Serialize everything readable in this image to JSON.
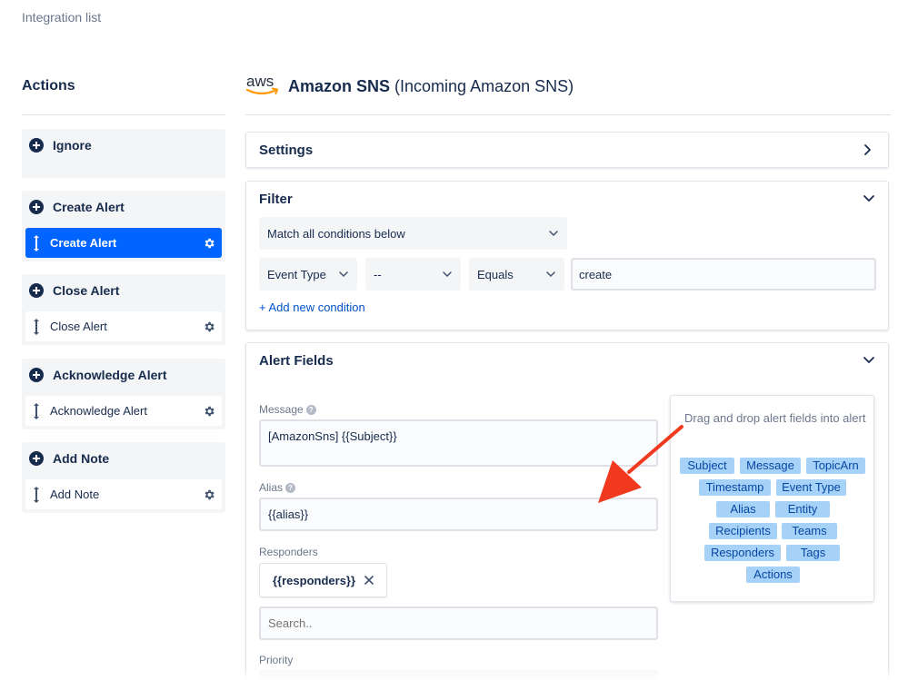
{
  "breadcrumb": "Integration list",
  "actions": {
    "title": "Actions",
    "groups": [
      {
        "head": "Ignore",
        "items": []
      },
      {
        "head": "Create Alert",
        "items": [
          {
            "label": "Create Alert",
            "active": true
          }
        ]
      },
      {
        "head": "Close Alert",
        "items": [
          {
            "label": "Close Alert",
            "active": false
          }
        ]
      },
      {
        "head": "Acknowledge Alert",
        "items": [
          {
            "label": "Acknowledge Alert",
            "active": false
          }
        ]
      },
      {
        "head": "Add Note",
        "items": [
          {
            "label": "Add Note",
            "active": false
          }
        ]
      }
    ]
  },
  "header": {
    "logo_text": "aws",
    "title_bold": "Amazon SNS",
    "title_rest": " (Incoming Amazon SNS)"
  },
  "settings": {
    "title": "Settings"
  },
  "filter": {
    "title": "Filter",
    "match_select": "Match all conditions below",
    "condition": {
      "field": "Event Type",
      "operator_not": "--",
      "operator": "Equals",
      "value": "create"
    },
    "add_condition": "+ Add new condition"
  },
  "alert_fields": {
    "title": "Alert Fields",
    "message_label": "Message",
    "message_value": "[AmazonSns] {{Subject}}",
    "alias_label": "Alias",
    "alias_value": "{{alias}}",
    "responders_label": "Responders",
    "responders_chip": "{{responders}}",
    "search_placeholder": "Search..",
    "priority_label": "Priority"
  },
  "dnd": {
    "text": "Drag and drop alert fields into alert",
    "tags": [
      "Subject",
      "Message",
      "TopicArn",
      "Timestamp",
      "Event Type",
      "Alias",
      "Entity",
      "Recipients",
      "Teams",
      "Responders",
      "Tags",
      "Actions"
    ]
  },
  "colors": {
    "primary": "#0065ff",
    "link": "#0052cc",
    "tag_bg": "#a6d2f7",
    "arrow": "#f0391e",
    "aws_orange": "#ff9900"
  }
}
